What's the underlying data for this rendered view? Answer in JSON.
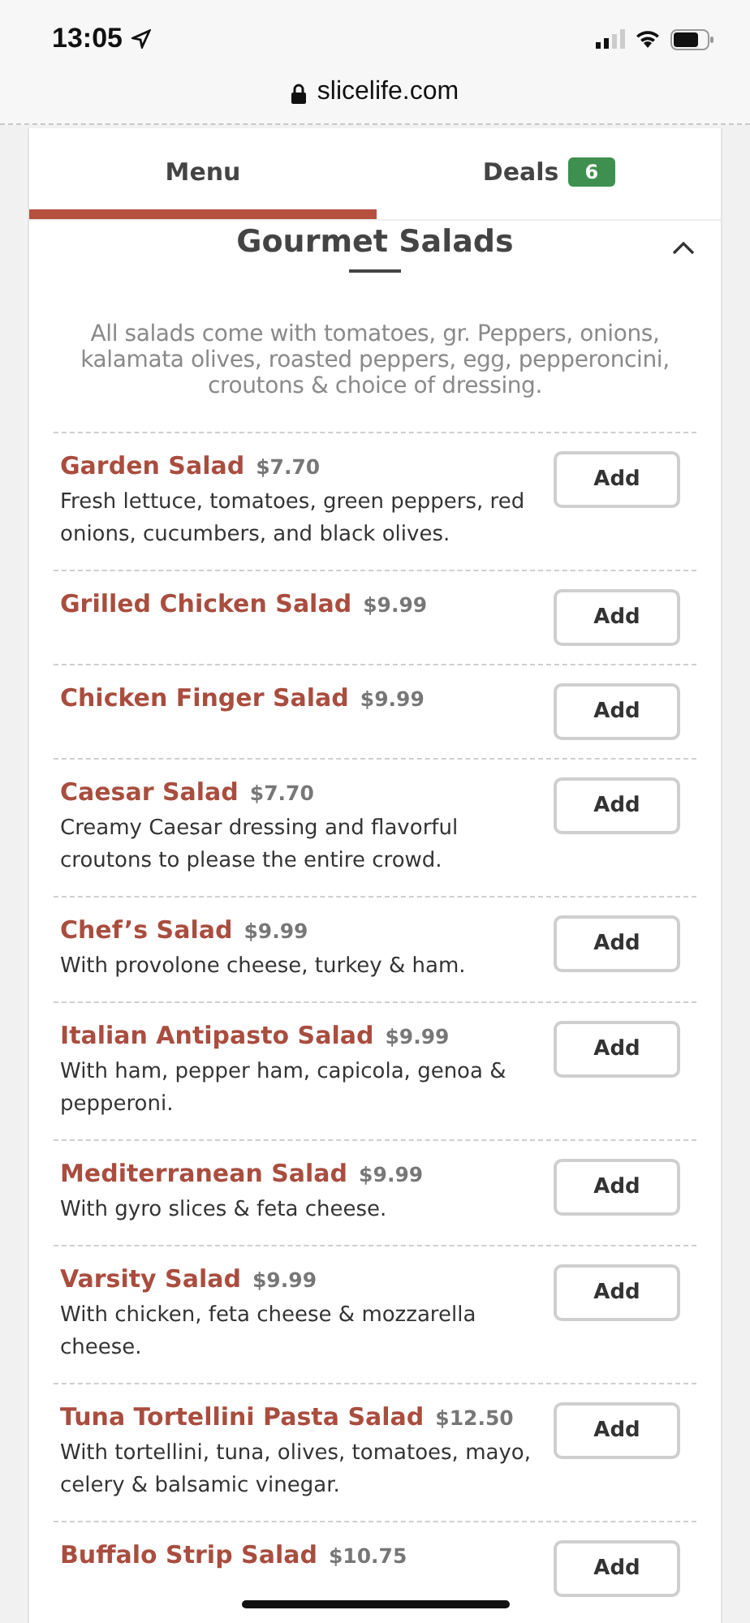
{
  "status_bar": {
    "time": "13:05"
  },
  "address_bar": {
    "url": "slicelife.com"
  },
  "tabs": [
    {
      "label": "Menu",
      "selected": true
    },
    {
      "label": "Deals",
      "selected": false,
      "badge": "6"
    }
  ],
  "section": {
    "title": "Gourmet Salads",
    "expanded": true,
    "note": "All salads come with tomatoes, gr. Peppers, onions, kalamata olives, roasted peppers, egg, pepperoncini, croutons & choice of dressing."
  },
  "items": [
    {
      "name": "Garden Salad",
      "price": "$7.70",
      "description": "Fresh lettuce, tomatoes, green peppers, red onions, cucumbers, and black olives.",
      "button": "Add"
    },
    {
      "name": "Grilled Chicken Salad",
      "price": "$9.99",
      "button": "Add"
    },
    {
      "name": "Chicken Finger Salad",
      "price": "$9.99",
      "button": "Add"
    },
    {
      "name": "Caesar Salad",
      "price": "$7.70",
      "description": "Creamy Caesar dressing and flavorful croutons to please the entire crowd.",
      "button": "Add"
    },
    {
      "name": "Chef’s Salad",
      "price": "$9.99",
      "description": "With provolone cheese, turkey & ham.",
      "button": "Add"
    },
    {
      "name": "Italian Antipasto Salad",
      "price": "$9.99",
      "description": "With ham, pepper ham, capicola, genoa & pepperoni.",
      "button": "Add"
    },
    {
      "name": "Mediterranean Salad",
      "price": "$9.99",
      "description": "With gyro slices & feta cheese.",
      "button": "Add"
    },
    {
      "name": "Varsity Salad",
      "price": "$9.99",
      "description": "With chicken, feta cheese & mozzarella cheese.",
      "button": "Add"
    },
    {
      "name": "Tuna Tortellini Pasta Salad",
      "price": "$12.50",
      "description": "With tortellini, tuna, olives, tomatoes, mayo, celery & balsamic vinegar.",
      "button": "Add"
    },
    {
      "name": "Buffalo Strip Salad",
      "price": "$10.75",
      "button": "Add"
    }
  ]
}
